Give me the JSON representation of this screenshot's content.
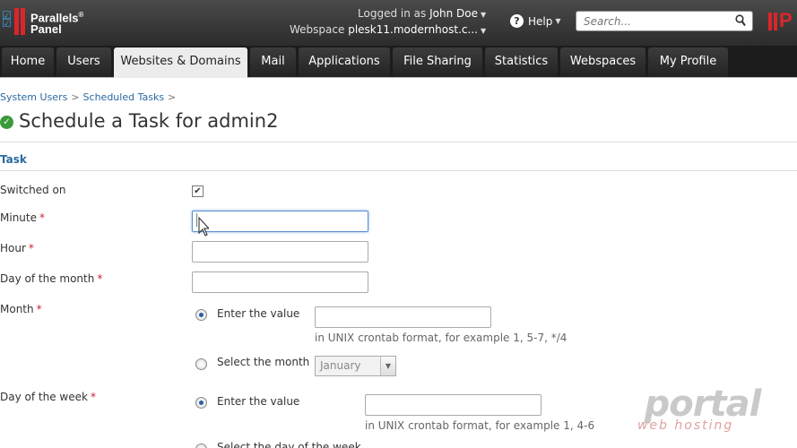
{
  "brand": {
    "line1": "Parallels",
    "line2": "Panel",
    "mark": "®"
  },
  "header": {
    "logged_in_label": "Logged in as",
    "user_name": "John Doe",
    "webspace_label": "Webspace",
    "webspace_value": "plesk11.modernhost.c...",
    "help_label": "Help",
    "search_placeholder": "Search...",
    "brand_letter": "P"
  },
  "nav": {
    "tabs": [
      {
        "label": "Home"
      },
      {
        "label": "Users"
      },
      {
        "label": "Websites & Domains"
      },
      {
        "label": "Mail"
      },
      {
        "label": "Applications"
      },
      {
        "label": "File Sharing"
      },
      {
        "label": "Statistics"
      },
      {
        "label": "Webspaces"
      },
      {
        "label": "My Profile"
      }
    ],
    "active_tab": "Websites & Domains"
  },
  "breadcrumb": {
    "items": [
      "System Users",
      "Scheduled Tasks"
    ],
    "separator": ">"
  },
  "page": {
    "title": "Schedule a Task for admin2",
    "section": "Task"
  },
  "form": {
    "switched_on": {
      "label": "Switched on",
      "checked": true
    },
    "minute": {
      "label": "Minute",
      "value": ""
    },
    "hour": {
      "label": "Hour",
      "value": ""
    },
    "day_of_month": {
      "label": "Day of the month",
      "value": ""
    },
    "month": {
      "label": "Month",
      "enter_value_label": "Enter the value",
      "value": "",
      "hint": "in UNIX crontab format, for example 1, 5-7, */4",
      "select_label": "Select the month",
      "select_value": "January"
    },
    "day_of_week": {
      "label": "Day of the week",
      "enter_value_label": "Enter the value",
      "value": "",
      "hint": "in UNIX crontab format, for example 1, 4-6",
      "select_label": "Select the day of the week"
    },
    "required_mark": "*"
  },
  "watermark": {
    "line1": "portal",
    "line2": "web hosting"
  },
  "colors": {
    "link": "#2a6aa0",
    "brand_red": "#d9262b",
    "success": "#3a9a3a"
  }
}
